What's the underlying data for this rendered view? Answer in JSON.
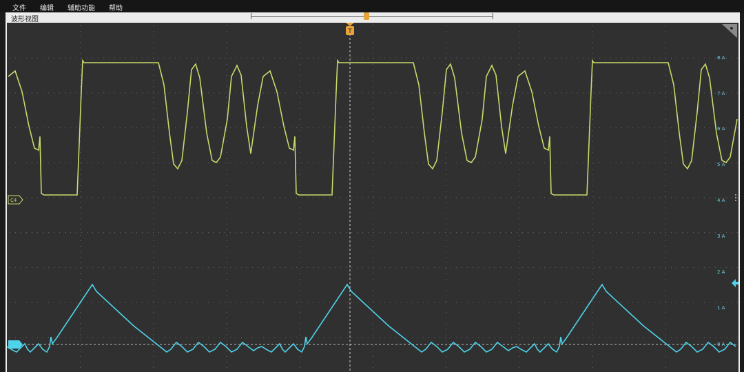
{
  "menu": {
    "file": "文件",
    "edit": "编辑",
    "utilities": "辅助功能",
    "help": "帮助"
  },
  "view": {
    "title": "波形视图"
  },
  "trigger": {
    "label": "T"
  },
  "channels": {
    "c4": {
      "label": "C4",
      "color": "#c8d96a"
    },
    "c2": {
      "color": "#4fd3ea"
    }
  },
  "axis": {
    "unit": "A",
    "ticks": [
      "8 A",
      "7 A",
      "6 A",
      "5 A",
      "4 A",
      "3 A",
      "2 A",
      "1 A",
      "0 A"
    ]
  },
  "colors": {
    "background": "#303030",
    "grid": "#6a6a6a",
    "trigger": "#e8a23a"
  }
}
